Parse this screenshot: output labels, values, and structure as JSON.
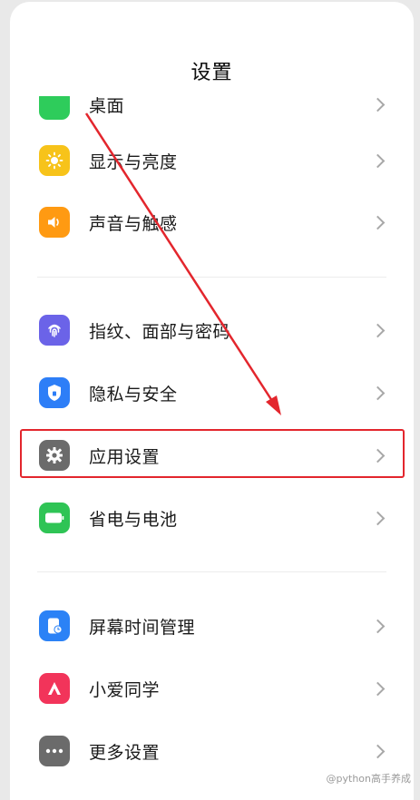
{
  "page": {
    "title": "设置"
  },
  "items": [
    {
      "label": "桌面",
      "icon": "desktop-icon",
      "color": "#2ecc5b"
    },
    {
      "label": "显示与亮度",
      "icon": "sun-icon",
      "color": "#f7c31a"
    },
    {
      "label": "声音与触感",
      "icon": "speaker-icon",
      "color": "#ff9a12"
    },
    {
      "label": "指纹、面部与密码",
      "icon": "fingerprint-icon",
      "color": "#6b63e8"
    },
    {
      "label": "隐私与安全",
      "icon": "shield-lock-icon",
      "color": "#2d7ef7"
    },
    {
      "label": "应用设置",
      "icon": "gear-icon",
      "color": "#6b6b6b"
    },
    {
      "label": "省电与电池",
      "icon": "battery-icon",
      "color": "#2fc455"
    },
    {
      "label": "屏幕时间管理",
      "icon": "screen-time-icon",
      "color": "#2b82f6"
    },
    {
      "label": "小爱同学",
      "icon": "xiaoai-icon",
      "color": "#f2345a"
    },
    {
      "label": "更多设置",
      "icon": "more-dots-icon",
      "color": "#6b6b6b"
    }
  ],
  "annotation": {
    "color": "#e3262d",
    "highlighted_item": "应用设置"
  },
  "watermark": "@python高手养成"
}
